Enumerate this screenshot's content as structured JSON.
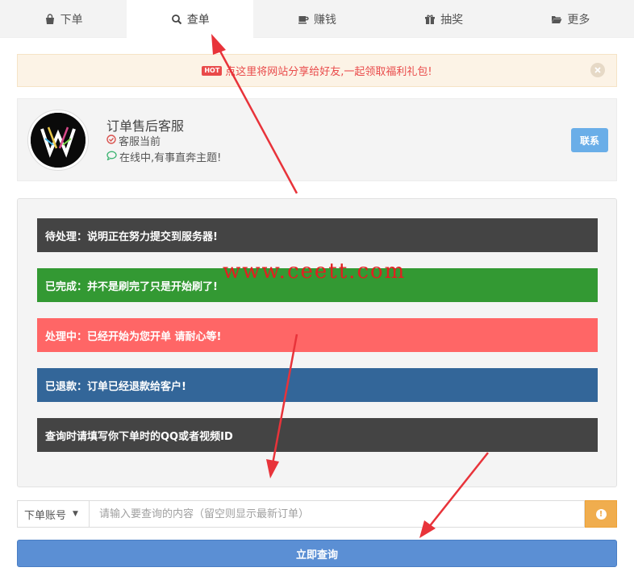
{
  "nav": {
    "items": [
      {
        "label": "下单",
        "icon": "shopping-bag-icon",
        "active": false
      },
      {
        "label": "查单",
        "icon": "search-icon",
        "active": true
      },
      {
        "label": "赚钱",
        "icon": "coffee-cup-icon",
        "active": false
      },
      {
        "label": "抽奖",
        "icon": "gift-icon",
        "active": false
      },
      {
        "label": "更多",
        "icon": "folder-open-icon",
        "active": false
      }
    ]
  },
  "notice": {
    "badge": "HOT",
    "text": "点这里将网站分享给好友,一起领取福利礼包!"
  },
  "service": {
    "name": "订单售后客服",
    "status": "客服当前",
    "online": "在线中,有事直奔主题!",
    "contact_label": "联系"
  },
  "statuses": [
    {
      "text": "待处理：说明正在努力提交到服务器!",
      "color": "#444444"
    },
    {
      "text": "已完成：并不是刷完了只是开始刷了!",
      "color": "#339933"
    },
    {
      "text": "处理中：已经开始为您开单 请耐心等!",
      "color": "#ff6666"
    },
    {
      "text": "已退款：订单已经退款给客户!",
      "color": "#336699"
    },
    {
      "text": "查询时请填写你下单时的QQ或者视频ID",
      "color": "#444444"
    }
  ],
  "watermark": "www.ceett.com",
  "query": {
    "select_value": "下单账号",
    "placeholder": "请输入要查询的内容（留空则显示最新订单）"
  },
  "submit_label": "立即查询",
  "colors": {
    "accent": "#5b8fd4",
    "warning": "#f0ad4e",
    "arrow": "#e8333a"
  }
}
